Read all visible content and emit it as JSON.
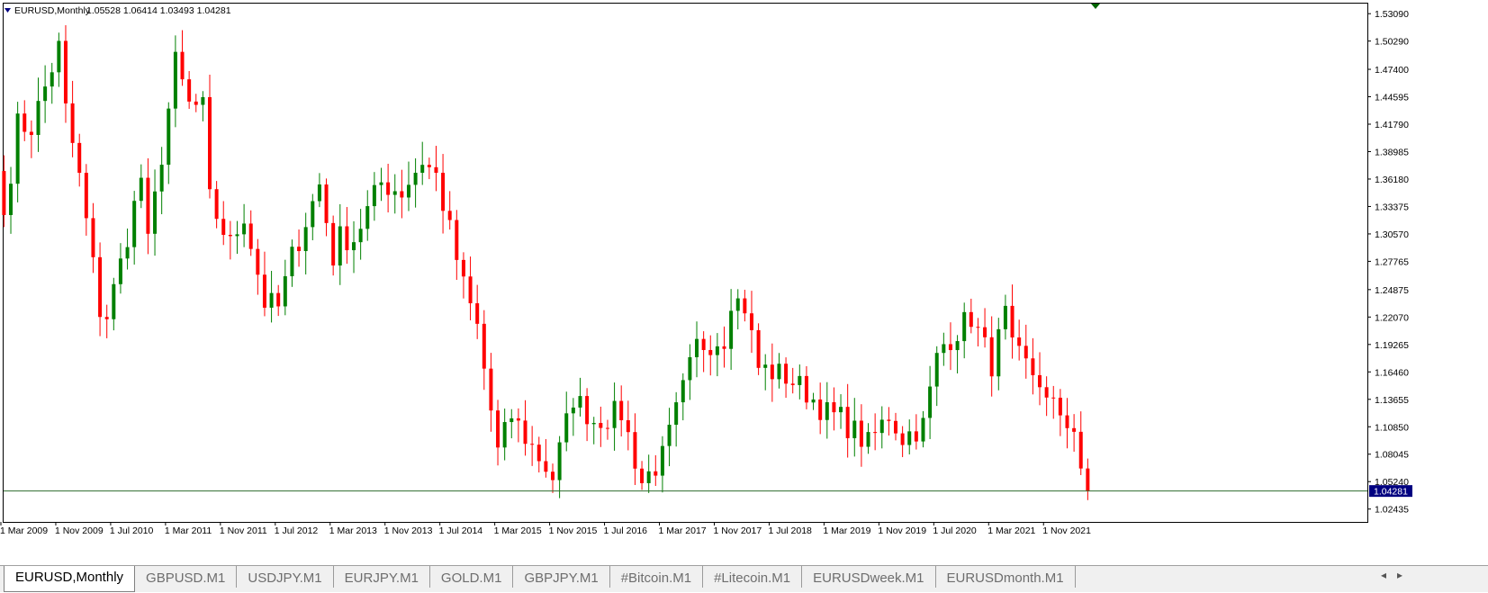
{
  "header": {
    "symbol": "EURUSD,Monthly",
    "ohlc": "1.05528 1.06414 1.03493 1.04281"
  },
  "colors": {
    "bull": "#008000",
    "bear": "#ff0000",
    "price_line": "#2e6b2e",
    "price_tag": "#000080"
  },
  "current_price": "1.04281",
  "tabs": [
    {
      "label": "EURUSD,Monthly",
      "active": true
    },
    {
      "label": "GBPUSD.M1",
      "active": false
    },
    {
      "label": "USDJPY.M1",
      "active": false
    },
    {
      "label": "EURJPY.M1",
      "active": false
    },
    {
      "label": "GOLD.M1",
      "active": false
    },
    {
      "label": "GBPJPY.M1",
      "active": false
    },
    {
      "label": "#Bitcoin.M1",
      "active": false
    },
    {
      "label": "#Litecoin.M1",
      "active": false
    },
    {
      "label": "EURUSDweek.M1",
      "active": false
    },
    {
      "label": "EURUSDmonth.M1",
      "active": false
    }
  ],
  "tab_nav": {
    "left": "◂",
    "right": "▸"
  },
  "chart_data": {
    "type": "candlestick",
    "ylim": [
      1.0112,
      1.5412
    ],
    "y_ticks": [
      "1.53090",
      "1.50290",
      "1.47400",
      "1.44595",
      "1.41790",
      "1.38985",
      "1.36180",
      "1.33375",
      "1.30570",
      "1.27765",
      "1.24875",
      "1.22070",
      "1.19265",
      "1.16460",
      "1.13655",
      "1.10850",
      "1.08045",
      "1.05240",
      "1.02435"
    ],
    "x_ticks": [
      "1 Mar 2009",
      "1 Nov 2009",
      "1 Jul 2010",
      "1 Mar 2011",
      "1 Nov 2011",
      "1 Jul 2012",
      "1 Mar 2013",
      "1 Nov 2013",
      "1 Jul 2014",
      "1 Mar 2015",
      "1 Nov 2015",
      "1 Jul 2016",
      "1 Mar 2017",
      "1 Nov 2017",
      "1 Jul 2018",
      "1 Mar 2019",
      "1 Nov 2019",
      "1 Jul 2020",
      "1 Mar 2021",
      "1 Nov 2021"
    ],
    "first_month": "2009-03",
    "pivots": [
      [
        "2009-03",
        1.325
      ],
      [
        "2009-05",
        1.417
      ],
      [
        "2009-07",
        1.415
      ],
      [
        "2009-11",
        1.496
      ],
      [
        "2009-12",
        1.432
      ],
      [
        "2010-02",
        1.363
      ],
      [
        "2010-05",
        1.228
      ],
      [
        "2010-06",
        1.222
      ],
      [
        "2010-08",
        1.275
      ],
      [
        "2010-11",
        1.364
      ],
      [
        "2010-12",
        1.294
      ],
      [
        "2011-04",
        1.48
      ],
      [
        "2011-06",
        1.437
      ],
      [
        "2011-08",
        1.434
      ],
      [
        "2011-09",
        1.34
      ],
      [
        "2011-12",
        1.294
      ],
      [
        "2012-02",
        1.326
      ],
      [
        "2012-05",
        1.236
      ],
      [
        "2012-07",
        1.23
      ],
      [
        "2012-09",
        1.282
      ],
      [
        "2013-01",
        1.356
      ],
      [
        "2013-03",
        1.282
      ],
      [
        "2013-04",
        1.302
      ],
      [
        "2013-06",
        1.301
      ],
      [
        "2013-10",
        1.358
      ],
      [
        "2014-01",
        1.349
      ],
      [
        "2014-04",
        1.381
      ],
      [
        "2014-06",
        1.365
      ],
      [
        "2014-10",
        1.252
      ],
      [
        "2014-12",
        1.21
      ],
      [
        "2015-02",
        1.125
      ],
      [
        "2015-03",
        1.082
      ],
      [
        "2015-05",
        1.12
      ],
      [
        "2015-07",
        1.098
      ],
      [
        "2015-11",
        1.057
      ],
      [
        "2016-02",
        1.139
      ],
      [
        "2016-05",
        1.115
      ],
      [
        "2016-09",
        1.123
      ],
      [
        "2016-12",
        1.052
      ],
      [
        "2017-03",
        1.077
      ],
      [
        "2017-08",
        1.191
      ],
      [
        "2017-12",
        1.2
      ],
      [
        "2018-01",
        1.241
      ],
      [
        "2018-03",
        1.232
      ],
      [
        "2018-05",
        1.169
      ],
      [
        "2018-09",
        1.16
      ],
      [
        "2018-12",
        1.144
      ],
      [
        "2019-03",
        1.122
      ],
      [
        "2019-05",
        1.117
      ],
      [
        "2019-09",
        1.09
      ],
      [
        "2019-12",
        1.121
      ],
      [
        "2020-02",
        1.098
      ],
      [
        "2020-05",
        1.11
      ],
      [
        "2020-07",
        1.178
      ],
      [
        "2020-08",
        1.193
      ],
      [
        "2020-12",
        1.221
      ],
      [
        "2021-03",
        1.173
      ],
      [
        "2021-05",
        1.222
      ],
      [
        "2021-06",
        1.186
      ],
      [
        "2021-10",
        1.156
      ],
      [
        "2021-11",
        1.132
      ],
      [
        "2022-01",
        1.123
      ],
      [
        "2022-03",
        1.106
      ],
      [
        "2022-04",
        1.055
      ],
      [
        "2022-05",
        1.043
      ]
    ]
  }
}
